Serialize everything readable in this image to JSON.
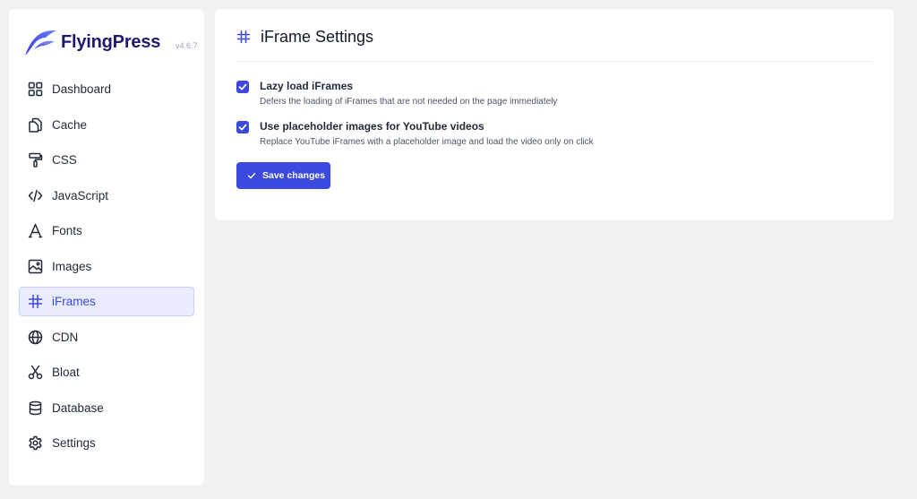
{
  "brand": {
    "name": "FlyingPress",
    "version": "v4.6.7"
  },
  "colors": {
    "accent": "#3b49df",
    "active_bg": "#e8ecfd",
    "page_bg": "#f1f1f1"
  },
  "sidebar": {
    "items": [
      {
        "label": "Dashboard",
        "icon": "dashboard-icon",
        "active": false
      },
      {
        "label": "Cache",
        "icon": "copy-icon",
        "active": false
      },
      {
        "label": "CSS",
        "icon": "paint-roller-icon",
        "active": false
      },
      {
        "label": "JavaScript",
        "icon": "code-icon",
        "active": false
      },
      {
        "label": "Fonts",
        "icon": "font-icon",
        "active": false
      },
      {
        "label": "Images",
        "icon": "image-icon",
        "active": false
      },
      {
        "label": "iFrames",
        "icon": "hash-icon",
        "active": true
      },
      {
        "label": "CDN",
        "icon": "globe-icon",
        "active": false
      },
      {
        "label": "Bloat",
        "icon": "scissors-icon",
        "active": false
      },
      {
        "label": "Database",
        "icon": "database-icon",
        "active": false
      },
      {
        "label": "Settings",
        "icon": "gear-icon",
        "active": false
      }
    ]
  },
  "main": {
    "title": "iFrame Settings",
    "title_icon": "hash-icon",
    "options": [
      {
        "title": "Lazy load iFrames",
        "description": "Defers the loading of iFrames that are not needed on the page immediately",
        "checked": true
      },
      {
        "title": "Use placeholder images for YouTube videos",
        "description": "Replace YouTube iFrames with a placeholder image and load the video only on click",
        "checked": true
      }
    ],
    "save_label": "Save changes"
  }
}
